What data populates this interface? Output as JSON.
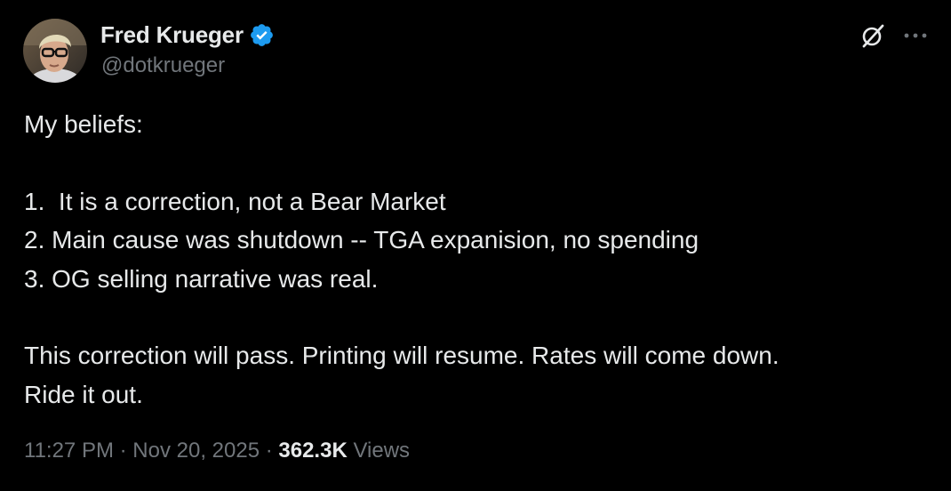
{
  "author": {
    "display_name": "Fred Krueger",
    "handle": "@dotkrueger",
    "verified": true
  },
  "tweet": {
    "lines": [
      "My beliefs:",
      "",
      "1.  It is a correction, not a Bear Market",
      "2. Main cause was shutdown -- TGA expanision, no spending",
      "3. OG selling narrative was real.",
      "",
      "This correction will pass. Printing will resume. Rates will come down.",
      "Ride it out."
    ]
  },
  "meta": {
    "time": "11:27 PM",
    "separator": " · ",
    "date": "Nov 20, 2025",
    "views_count": "362.3K",
    "views_label": "Views"
  },
  "icons": {
    "verified": "verified-badge-icon",
    "grok": "grok-icon",
    "more": "more-options-icon"
  },
  "colors": {
    "background": "#000000",
    "primary_text": "#e7e9ea",
    "secondary_text": "#71767b",
    "verified_blue": "#1d9bf0"
  }
}
